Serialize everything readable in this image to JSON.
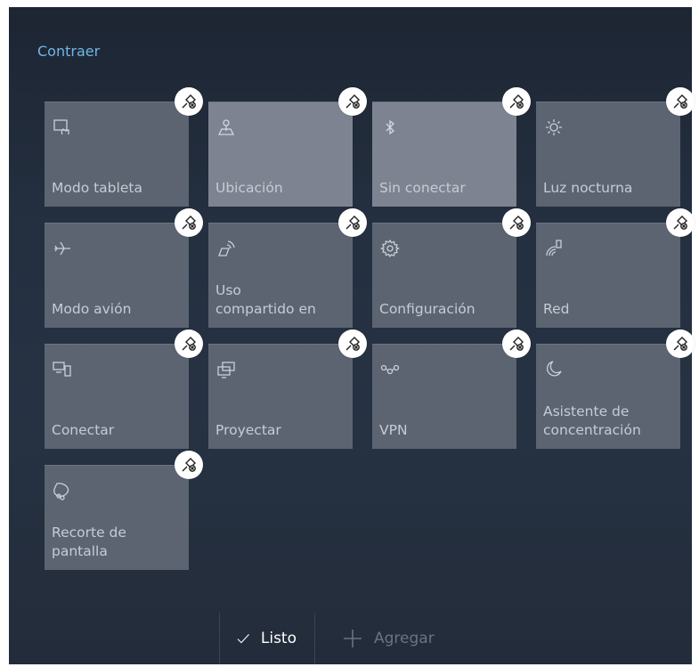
{
  "header": {
    "collapse_label": "Contraer"
  },
  "tiles": [
    {
      "label": "Modo tableta",
      "icon": "tablet-mode-icon",
      "state": "off"
    },
    {
      "label": "Ubicación",
      "icon": "location-icon",
      "state": "on"
    },
    {
      "label": "Sin conectar",
      "icon": "bluetooth-icon",
      "state": "on"
    },
    {
      "label": "Luz nocturna",
      "icon": "night-light-icon",
      "state": "off"
    },
    {
      "label": "Modo avión",
      "icon": "airplane-icon",
      "state": "off"
    },
    {
      "label": "Uso\ncompartido en",
      "icon": "nearby-sharing-icon",
      "state": "off"
    },
    {
      "label": "Configuración",
      "icon": "settings-gear-icon",
      "state": "off"
    },
    {
      "label": "Red",
      "icon": "network-icon",
      "state": "off"
    },
    {
      "label": "Conectar",
      "icon": "connect-icon",
      "state": "off"
    },
    {
      "label": "Proyectar",
      "icon": "project-icon",
      "state": "off"
    },
    {
      "label": "VPN",
      "icon": "vpn-icon",
      "state": "off"
    },
    {
      "label": "Asistente de\nconcentración",
      "icon": "focus-assist-moon-icon",
      "state": "off"
    },
    {
      "label": "Recorte de\npantalla",
      "icon": "screen-snip-icon",
      "state": "off"
    }
  ],
  "footer": {
    "done_label": "Listo",
    "add_label": "Agregar"
  },
  "colors": {
    "accent": "#6fb6e8",
    "tile_off": "#5c6472",
    "tile_on": "#7d8390",
    "background": "#232c3a"
  }
}
